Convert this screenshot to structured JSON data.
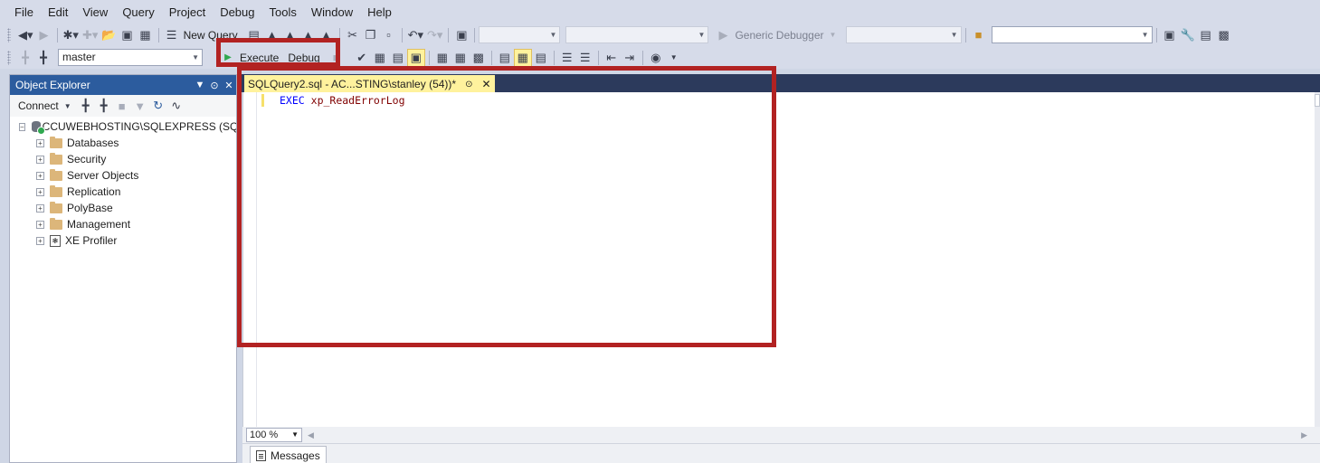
{
  "menu": [
    "File",
    "Edit",
    "View",
    "Query",
    "Project",
    "Debug",
    "Tools",
    "Window",
    "Help"
  ],
  "toolbar1": {
    "new_query_label": "New Query",
    "solution_config": "",
    "solution_platform": "",
    "debugger_label": "Generic Debugger",
    "debug_target": "",
    "search_value": ""
  },
  "toolbar2": {
    "database": "master",
    "execute_label": "Execute",
    "debug_label": "Debug"
  },
  "object_explorer": {
    "title": "Object Explorer",
    "connect_label": "Connect",
    "server_label": "ACCUWEBHOSTING\\SQLEXPRESS (SQL",
    "nodes": [
      "Databases",
      "Security",
      "Server Objects",
      "Replication",
      "PolyBase",
      "Management"
    ],
    "xe_profiler": "XE Profiler"
  },
  "document_tab": {
    "title": "SQLQuery2.sql - AC...STING\\stanley (54))*"
  },
  "editor": {
    "keyword": "EXEC",
    "procedure": "xp_ReadErrorLog"
  },
  "zoom": "100 %",
  "results": {
    "messages_tab": "Messages"
  },
  "colors": {
    "annotation": "#b22222",
    "explorer_header": "#2c5c9e",
    "active_tab": "#fff29d",
    "keyword": "#0000ff",
    "procedure": "#800000"
  }
}
